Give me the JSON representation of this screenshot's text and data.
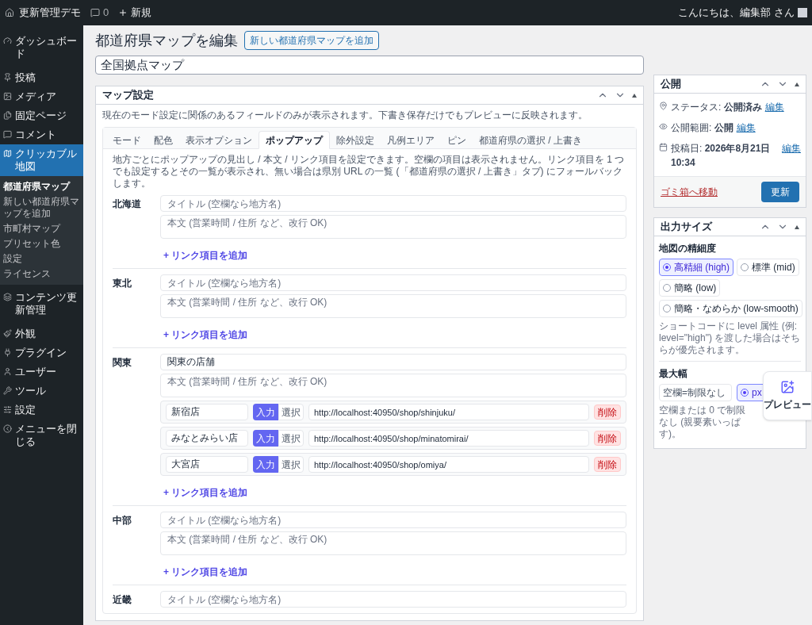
{
  "admin_bar": {
    "site_name": "更新管理デモ",
    "comments_count": "0",
    "new_label": "新規",
    "greeting": "こんにちは、編集部 さん"
  },
  "sidebar": {
    "items": [
      {
        "label": "ダッシュボード",
        "selected": false
      },
      {
        "label": "投稿",
        "selected": false
      },
      {
        "label": "メディア",
        "selected": false
      },
      {
        "label": "固定ページ",
        "selected": false
      },
      {
        "label": "コメント",
        "selected": false
      },
      {
        "label": "クリッカブル地図",
        "selected": true,
        "children": [
          {
            "label": "都道府県マップ",
            "selected": true
          },
          {
            "label": "新しい都道府県マップを追加",
            "selected": false
          },
          {
            "label": "市町村マップ",
            "selected": false
          },
          {
            "label": "プリセット色",
            "selected": false
          },
          {
            "label": "設定",
            "selected": false
          },
          {
            "label": "ライセンス",
            "selected": false
          }
        ]
      },
      {
        "label": "コンテンツ更新管理",
        "selected": false
      },
      {
        "label": "外観",
        "selected": false
      },
      {
        "label": "プラグイン",
        "selected": false
      },
      {
        "label": "ユーザー",
        "selected": false
      },
      {
        "label": "ツール",
        "selected": false
      },
      {
        "label": "設定",
        "selected": false
      },
      {
        "label": "メニューを閉じる",
        "selected": false
      }
    ]
  },
  "page": {
    "title": "都道府県マップを編集",
    "add_button": "新しい都道府県マップを追加",
    "post_title": "全国拠点マップ"
  },
  "map_settings": {
    "title": "マップ設定",
    "note": "現在のモード設定に関係のあるフィールドのみが表示されます。下書き保存だけでもプレビューに反映されます。",
    "tabs": [
      {
        "label": "モード",
        "selected": false
      },
      {
        "label": "配色",
        "selected": false
      },
      {
        "label": "表示オプション",
        "selected": false
      },
      {
        "label": "ポップアップ",
        "selected": true
      },
      {
        "label": "除外設定",
        "selected": false
      },
      {
        "label": "凡例エリア",
        "selected": false
      },
      {
        "label": "ピン",
        "selected": false
      },
      {
        "label": "都道府県の選択 / 上書き",
        "selected": false
      }
    ],
    "popup_note": "地方ごとにポップアップの見出し / 本文 / リンク項目を設定できます。空欄の項目は表示されません。リンク項目を 1 つでも設定するとその一覧が表示され、無い場合は県別 URL の一覧 (「都道府県の選択 / 上書き」タブ) にフォールバックします。",
    "regions": [
      {
        "name": "北海道",
        "title_placeholder": "タイトル (空欄なら地方名)",
        "body_placeholder": "本文 (営業時間 / 住所 など、改行 OK)",
        "add_link": "+ リンク項目を追加"
      },
      {
        "name": "東北",
        "title_placeholder": "タイトル (空欄なら地方名)",
        "body_placeholder": "本文 (営業時間 / 住所 など、改行 OK)",
        "add_link": "+ リンク項目を追加"
      },
      {
        "name": "関東",
        "title_value": "関東の店舗",
        "body_placeholder": "本文 (営業時間 / 住所 など、改行 OK)",
        "links": [
          {
            "label": "新宿店",
            "modes": [
              {
                "label": "入力",
                "selected": true
              },
              {
                "label": "選択",
                "selected": false
              }
            ],
            "url": "http://localhost:40950/shop/shinjuku/",
            "delete": "削除"
          },
          {
            "label": "みなとみらい店",
            "modes": [
              {
                "label": "入力",
                "selected": true
              },
              {
                "label": "選択",
                "selected": false
              }
            ],
            "url": "http://localhost:40950/shop/minatomirai/",
            "delete": "削除"
          },
          {
            "label": "大宮店",
            "modes": [
              {
                "label": "入力",
                "selected": true
              },
              {
                "label": "選択",
                "selected": false
              }
            ],
            "url": "http://localhost:40950/shop/omiya/",
            "delete": "削除"
          }
        ],
        "add_link": "+ リンク項目を追加"
      },
      {
        "name": "中部",
        "title_placeholder": "タイトル (空欄なら地方名)",
        "body_placeholder": "本文 (営業時間 / 住所 など、改行 OK)",
        "add_link": "+ リンク項目を追加"
      },
      {
        "name": "近畿",
        "title_placeholder": "タイトル (空欄なら地方名)"
      }
    ]
  },
  "publish": {
    "title": "公開",
    "rows": [
      {
        "label": "ステータス:",
        "value": "公開済み",
        "edit": "編集"
      },
      {
        "label": "公開範囲:",
        "value": "公開",
        "edit": "編集"
      },
      {
        "label": "投稿日:",
        "value": "2026年8月21日 10:34",
        "edit": "編集"
      }
    ],
    "trash": "ゴミ箱へ移動",
    "update": "更新"
  },
  "output_size": {
    "title": "出力サイズ",
    "detail_label": "地図の精細度",
    "options": [
      {
        "label": "高精細 (high)",
        "selected": true
      },
      {
        "label": "標準 (mid)",
        "selected": false
      },
      {
        "label": "簡略 (low)",
        "selected": false
      },
      {
        "label": "簡略・なめらか (low-smooth)",
        "selected": false
      }
    ],
    "note": "ショートコードに level 属性 (例: level=\"high\") を渡した場合はそちらが優先されます。",
    "max_width_label": "最大幅",
    "max_width_placeholder": "空欄=制限なし",
    "units": [
      {
        "label": "px",
        "selected": true
      }
    ],
    "max_width_note": [
      "空欄または 0 で制限なし (親要素いっぱ",
      "す)。"
    ]
  },
  "preview_button": "プレビュー"
}
